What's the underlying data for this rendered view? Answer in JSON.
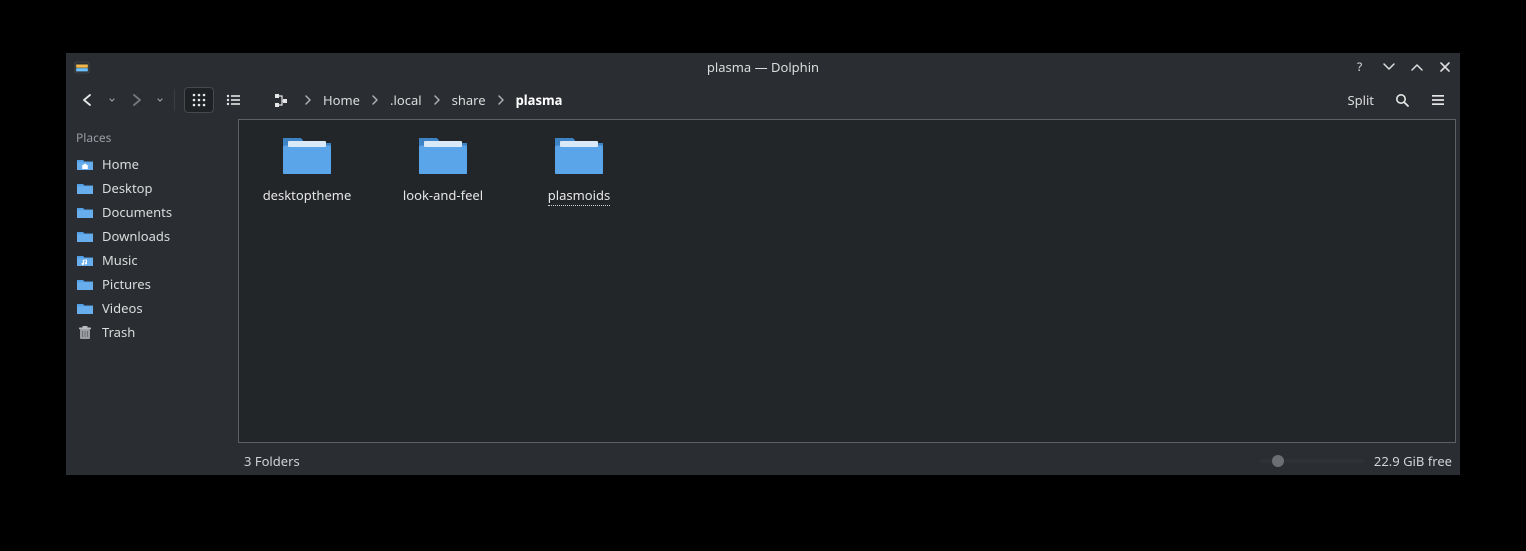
{
  "window": {
    "title": "plasma — Dolphin"
  },
  "breadcrumbs": {
    "items": [
      {
        "label": "Home",
        "current": false
      },
      {
        "label": ".local",
        "current": false
      },
      {
        "label": "share",
        "current": false
      },
      {
        "label": "plasma",
        "current": true
      }
    ]
  },
  "toolbar": {
    "split_label": "Split"
  },
  "sidebar": {
    "section": "Places",
    "places": [
      {
        "label": "Home",
        "icon": "home"
      },
      {
        "label": "Desktop",
        "icon": "folder"
      },
      {
        "label": "Documents",
        "icon": "folder"
      },
      {
        "label": "Downloads",
        "icon": "folder"
      },
      {
        "label": "Music",
        "icon": "music"
      },
      {
        "label": "Pictures",
        "icon": "folder"
      },
      {
        "label": "Videos",
        "icon": "folder"
      },
      {
        "label": "Trash",
        "icon": "trash"
      }
    ]
  },
  "folders": [
    {
      "label": "desktoptheme",
      "selected": false
    },
    {
      "label": "look-and-feel",
      "selected": false
    },
    {
      "label": "plasmoids",
      "selected": true
    }
  ],
  "status": {
    "left": "3 Folders",
    "free": "22.9 GiB free"
  },
  "colors": {
    "folder": "#54a0e8",
    "folder_dark": "#3d82c4",
    "accent": "#3daee9"
  }
}
